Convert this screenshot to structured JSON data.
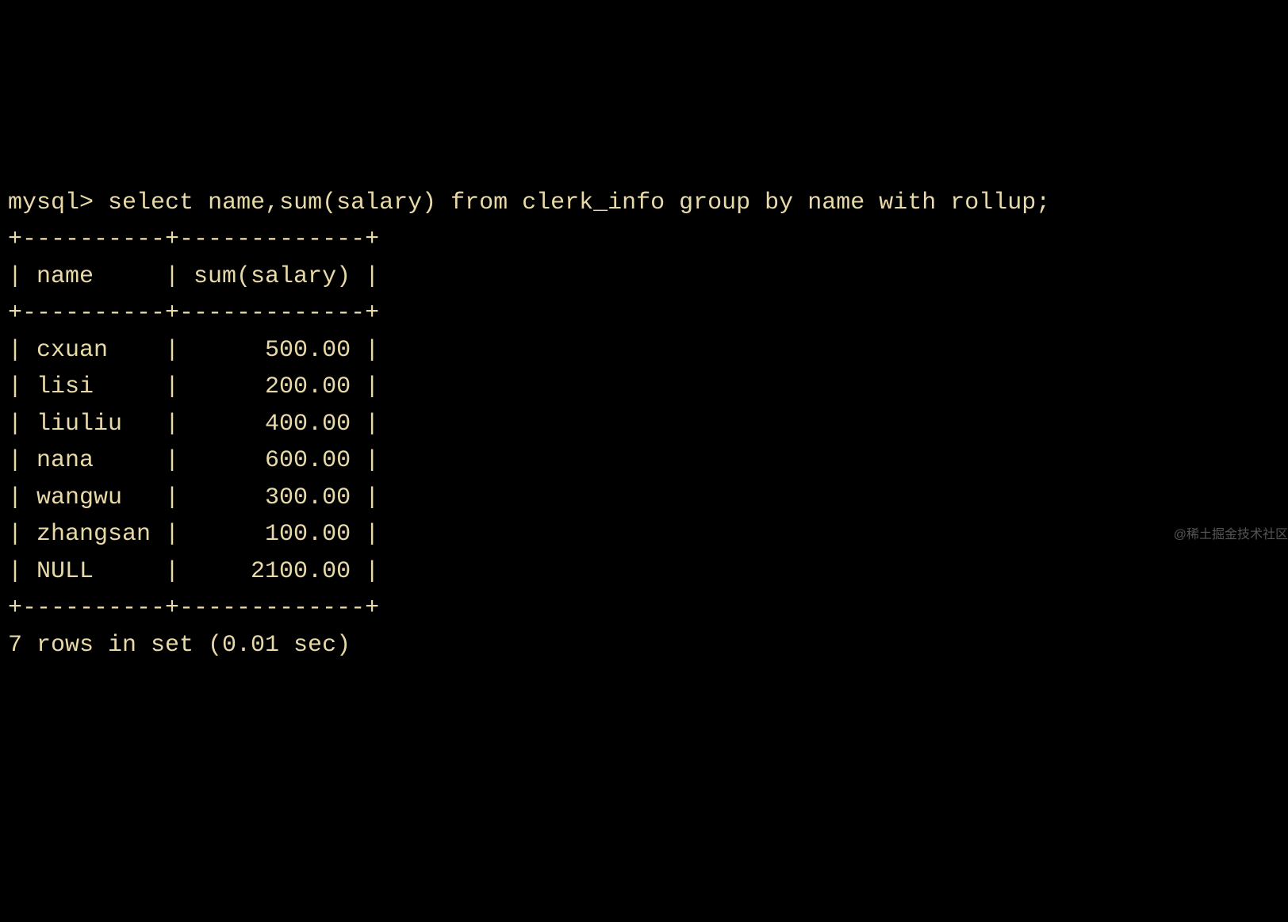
{
  "prompt": "mysql>",
  "command": "select name,sum(salary) from clerk_info group by name with rollup;",
  "table": {
    "border_top": "+----------+-------------+",
    "border_mid": "+----------+-------------+",
    "border_bottom": "+----------+-------------+",
    "headers": [
      "name",
      "sum(salary)"
    ],
    "header_line": "| name     | sum(salary) |",
    "rows": [
      {
        "name": "cxuan",
        "salary": "500.00",
        "line": "| cxuan    |      500.00 |"
      },
      {
        "name": "lisi",
        "salary": "200.00",
        "line": "| lisi     |      200.00 |"
      },
      {
        "name": "liuliu",
        "salary": "400.00",
        "line": "| liuliu   |      400.00 |"
      },
      {
        "name": "nana",
        "salary": "600.00",
        "line": "| nana     |      600.00 |"
      },
      {
        "name": "wangwu",
        "salary": "300.00",
        "line": "| wangwu   |      300.00 |"
      },
      {
        "name": "zhangsan",
        "salary": "100.00",
        "line": "| zhangsan |      100.00 |"
      },
      {
        "name": "NULL",
        "salary": "2100.00",
        "line": "| NULL     |     2100.00 |"
      }
    ]
  },
  "status": "7 rows in set (0.01 sec)",
  "watermark": "@稀土掘金技术社区"
}
